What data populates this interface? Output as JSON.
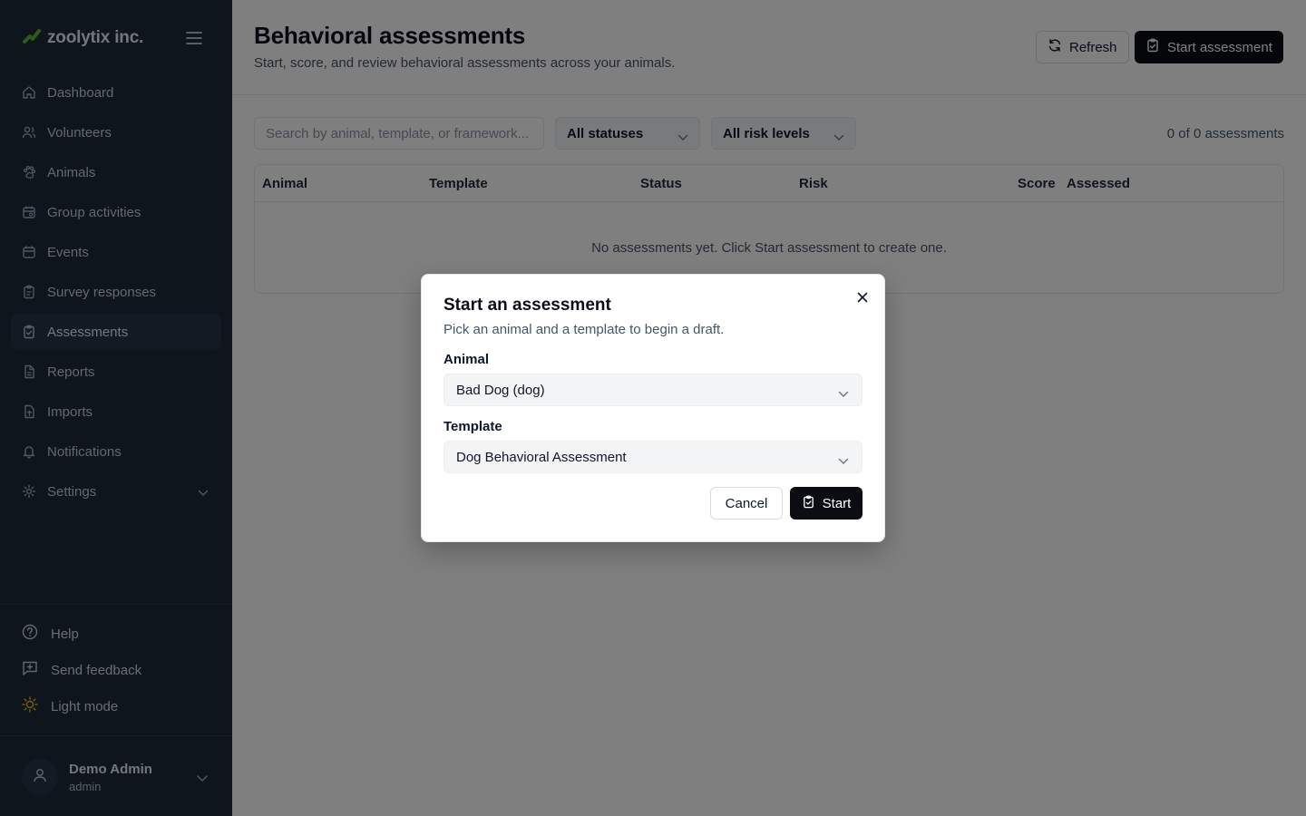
{
  "brand": {
    "name": "zoolytix inc.",
    "logo_icon": "leaf-logo-icon",
    "accent": "#65b32e"
  },
  "sidebar": {
    "menu_icon": "hamburger-icon",
    "items": [
      {
        "label": "Dashboard",
        "icon": "home-icon"
      },
      {
        "label": "Volunteers",
        "icon": "users-icon"
      },
      {
        "label": "Animals",
        "icon": "paw-icon"
      },
      {
        "label": "Group activities",
        "icon": "calendar-group-icon"
      },
      {
        "label": "Events",
        "icon": "calendar-icon"
      },
      {
        "label": "Survey responses",
        "icon": "clipboard-icon"
      },
      {
        "label": "Assessments",
        "icon": "clipboard-check-icon",
        "active": true
      },
      {
        "label": "Reports",
        "icon": "file-icon"
      },
      {
        "label": "Imports",
        "icon": "upload-icon"
      },
      {
        "label": "Notifications",
        "icon": "bell-icon"
      },
      {
        "label": "Settings",
        "icon": "gear-icon"
      }
    ],
    "bottom": {
      "help": "Help",
      "feedback": "Send feedback",
      "theme": "Light mode"
    },
    "user": {
      "name": "Demo Admin",
      "role": "admin"
    }
  },
  "header": {
    "title": "Behavioral assessments",
    "subtitle": "Start, score, and review behavioral assessments across your animals.",
    "refresh_label": "Refresh",
    "start_label": "Start assessment"
  },
  "filters": {
    "search_placeholder": "Search by animal, template, or framework...",
    "status_value": "All statuses",
    "risk_value": "All risk levels",
    "count_text": "0 of 0 assessments"
  },
  "table": {
    "columns": [
      "Animal",
      "Template",
      "Status",
      "Risk",
      "Score",
      "Assessed"
    ],
    "rows": [],
    "empty_text": "No assessments yet. Click Start assessment to create one."
  },
  "modal": {
    "title": "Start an assessment",
    "description": "Pick an animal and a template to begin a draft.",
    "animal_label": "Animal",
    "animal_value": "Bad Dog (dog)",
    "template_label": "Template",
    "template_value": "Dog Behavioral Assessment",
    "cancel_label": "Cancel",
    "start_label": "Start"
  },
  "colors": {
    "sidebar_bg": "#1c2a3b",
    "primary_button": "#0b0d12",
    "theme_icon": "#f2b705"
  }
}
